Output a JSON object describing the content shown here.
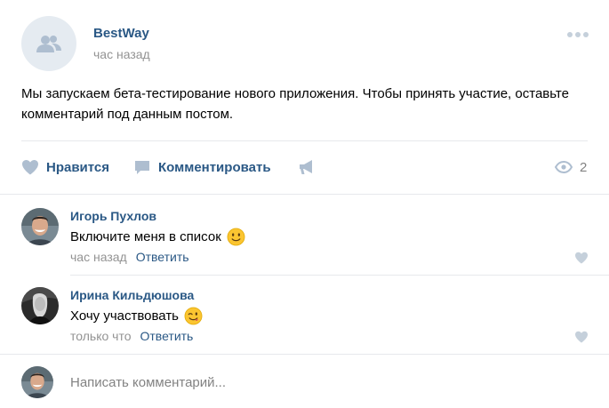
{
  "post": {
    "author": "BestWay",
    "time": "час назад",
    "text": "Мы запускаем бета-тестирование нового приложения. Чтобы принять участие, оставьте комментарий под данным постом."
  },
  "actions": {
    "like_label": "Нравится",
    "comment_label": "Комментировать",
    "views_count": "2"
  },
  "comments": [
    {
      "author": "Игорь Пухлов",
      "text": "Включите меня в список",
      "emoji": "slightly-smiling-face",
      "time": "час назад",
      "reply_label": "Ответить"
    },
    {
      "author": "Ирина Кильдюшова",
      "text": "Хочу участвовать",
      "emoji": "winking-face",
      "time": "только что",
      "reply_label": "Ответить"
    }
  ],
  "composer": {
    "placeholder": "Написать комментарий..."
  },
  "colors": {
    "link": "#2a5885",
    "meta": "#939393",
    "icon": "#aebed0",
    "divider": "#e7e8ec",
    "avatar_bg": "#e5ebf1"
  },
  "icons": [
    "group-avatar-icon",
    "more-icon",
    "heart-icon",
    "comment-icon",
    "megaphone-icon",
    "eye-icon",
    "slightly-smiling-face-icon",
    "winking-face-icon"
  ]
}
